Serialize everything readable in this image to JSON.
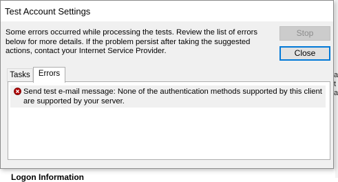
{
  "background": {
    "heading": "Logon Information",
    "fragments": [
      "at",
      "t",
      "at"
    ]
  },
  "dialog": {
    "title": "Test Account Settings",
    "message": "Some errors occurred while processing the tests. Review the list of errors below for more details. If the problem persist after taking the suggested actions, contact your Internet Service Provider.",
    "buttons": {
      "stop": "Stop",
      "close": "Close"
    },
    "tabs": [
      {
        "label": "Tasks",
        "selected": false
      },
      {
        "label": "Errors",
        "selected": true
      }
    ],
    "errors": [
      {
        "icon": "error-icon",
        "text": "Send test e-mail message: None of the authentication methods supported by this client are supported by your server."
      }
    ]
  },
  "colors": {
    "accent": "#0078d7",
    "error_icon": "#b00000"
  }
}
